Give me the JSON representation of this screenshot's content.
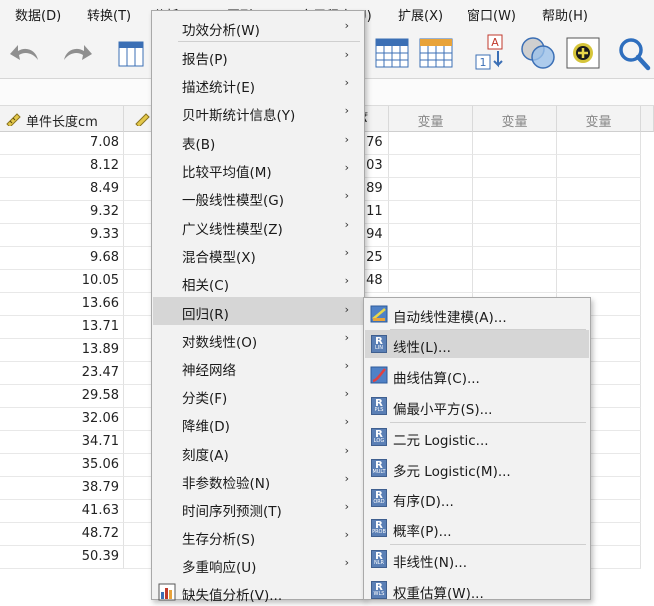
{
  "menubar": {
    "items": [
      {
        "label": "数据(D)"
      },
      {
        "label": "转换(T)"
      },
      {
        "label": "分析(A)"
      },
      {
        "label": "图形(G)"
      },
      {
        "label": "实用程序(U)"
      },
      {
        "label": "扩展(X)"
      },
      {
        "label": "窗口(W)"
      },
      {
        "label": "帮助(H)"
      }
    ]
  },
  "grid": {
    "col1_header": "单件长度cm",
    "var_header": "变量",
    "col1_values": [
      "7.08",
      "8.12",
      "8.49",
      "9.32",
      "9.33",
      "9.68",
      "10.05",
      "13.66",
      "13.71",
      "13.89",
      "23.47",
      "29.58",
      "32.06",
      "34.71",
      "35.06",
      "38.79",
      "41.63",
      "48.72",
      "50.39"
    ],
    "col3_partial_header": "₹",
    "col3_partial_values": [
      ".76",
      ".03",
      ".89",
      ".11",
      ".94",
      ".25",
      ".48"
    ]
  },
  "analyze_menu": {
    "items": [
      {
        "label": "功效分析(W)",
        "submenu": true
      },
      {
        "label": "报告(P)",
        "submenu": true
      },
      {
        "label": "描述统计(E)",
        "submenu": true
      },
      {
        "label": "贝叶斯统计信息(Y)",
        "submenu": true
      },
      {
        "label": "表(B)",
        "submenu": true
      },
      {
        "label": "比较平均值(M)",
        "submenu": true
      },
      {
        "label": "一般线性模型(G)",
        "submenu": true
      },
      {
        "label": "广义线性模型(Z)",
        "submenu": true
      },
      {
        "label": "混合模型(X)",
        "submenu": true
      },
      {
        "label": "相关(C)",
        "submenu": true
      },
      {
        "label": "回归(R)",
        "submenu": true,
        "highlighted": true
      },
      {
        "label": "对数线性(O)",
        "submenu": true
      },
      {
        "label": "神经网络",
        "submenu": true
      },
      {
        "label": "分类(F)",
        "submenu": true
      },
      {
        "label": "降维(D)",
        "submenu": true
      },
      {
        "label": "刻度(A)",
        "submenu": true
      },
      {
        "label": "非参数检验(N)",
        "submenu": true
      },
      {
        "label": "时间序列预测(T)",
        "submenu": true
      },
      {
        "label": "生存分析(S)",
        "submenu": true
      },
      {
        "label": "多重响应(U)",
        "submenu": true
      },
      {
        "label": "缺失值分析(V)...",
        "submenu": false
      }
    ],
    "arrow": "›"
  },
  "regression_menu": {
    "items": [
      {
        "label": "自动线性建模(A)...",
        "icon": "auto-linear-icon"
      },
      {
        "label": "线性(L)...",
        "icon": "r-lin-icon",
        "badge": "LIN",
        "highlighted": true
      },
      {
        "label": "曲线估算(C)...",
        "icon": "curve-icon"
      },
      {
        "label": "偏最小平方(S)...",
        "icon": "r-pls-icon",
        "badge": "PLS"
      },
      {
        "label": "二元 Logistic...",
        "icon": "r-log-icon",
        "badge": "LOG"
      },
      {
        "label": "多元 Logistic(M)...",
        "icon": "r-mult-icon",
        "badge": "MULT"
      },
      {
        "label": "有序(D)...",
        "icon": "r-ord-icon",
        "badge": "ORD"
      },
      {
        "label": "概率(P)...",
        "icon": "r-prob-icon",
        "badge": "PROB"
      },
      {
        "label": "非线性(N)...",
        "icon": "r-nlr-icon",
        "badge": "NLR"
      },
      {
        "label": "权重估算(W)...",
        "icon": "r-wls-icon",
        "badge": "WLS"
      }
    ],
    "r_letter": "R"
  },
  "colors": {
    "menu_bg": "#f2f2f2",
    "highlight": "#d6d6d6",
    "r_icon": "#5a7fb5"
  }
}
